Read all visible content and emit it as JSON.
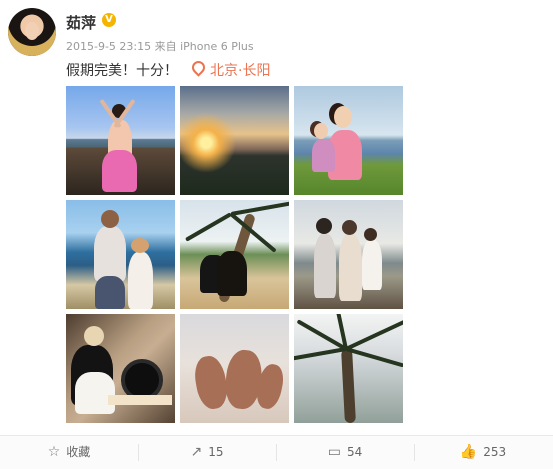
{
  "post": {
    "author": "茹萍",
    "verified_mark": "V",
    "meta": "2015-9-5 23:15 来自 iPhone 6 Plus",
    "text": "假期完美！十分！",
    "location": "北京·长阳"
  },
  "photos": [
    {
      "name": "beach-pose-photo"
    },
    {
      "name": "sunset-photo"
    },
    {
      "name": "mother-daughter-grass-photo"
    },
    {
      "name": "father-daughter-sea-photo"
    },
    {
      "name": "palm-beach-photo"
    },
    {
      "name": "family-seaside-photo"
    },
    {
      "name": "sewing-photo"
    },
    {
      "name": "deer-photo"
    },
    {
      "name": "palm-tree-photo"
    }
  ],
  "toolbar": {
    "favorite_label": "收藏",
    "repost_count": "15",
    "comment_count": "54",
    "like_count": "253"
  },
  "icons": {
    "favorite": "star-icon",
    "repost": "share-icon",
    "comment": "comment-icon",
    "like": "thumbs-up-icon"
  },
  "colors": {
    "location": "#eb7350",
    "verified": "#f5b400",
    "meta": "#999999"
  }
}
